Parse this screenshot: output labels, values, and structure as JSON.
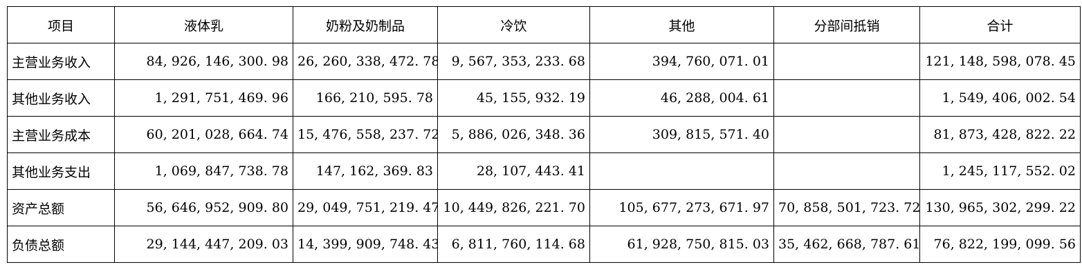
{
  "table": {
    "headers": [
      "项目",
      "液体乳",
      "奶粉及奶制品",
      "冷饮",
      "其他",
      "分部间抵销",
      "合计"
    ],
    "rows": [
      {
        "label": "主营业务收入",
        "cells": [
          "84, 926, 146, 300. 98",
          "26, 260, 338, 472. 78",
          "9, 567, 353, 233. 68",
          "394, 760, 071. 01",
          "",
          "121, 148, 598, 078. 45"
        ]
      },
      {
        "label": "其他业务收入",
        "cells": [
          "1, 291, 751, 469. 96",
          "166, 210, 595. 78",
          "45, 155, 932. 19",
          "46, 288, 004. 61",
          "",
          "1, 549, 406, 002. 54"
        ]
      },
      {
        "label": "主营业务成本",
        "cells": [
          "60, 201, 028, 664. 74",
          "15, 476, 558, 237. 72",
          "5, 886, 026, 348. 36",
          "309, 815, 571. 40",
          "",
          "81, 873, 428, 822. 22"
        ]
      },
      {
        "label": "其他业务支出",
        "cells": [
          "1, 069, 847, 738. 78",
          "147, 162, 369. 83",
          "28, 107, 443. 41",
          "",
          "",
          "1, 245, 117, 552. 02"
        ]
      },
      {
        "label": "资产总额",
        "cells": [
          "56, 646, 952, 909. 80",
          "29, 049, 751, 219. 47",
          "10, 449, 826, 221. 70",
          "105, 677, 273, 671. 97",
          "70, 858, 501, 723. 72",
          "130, 965, 302, 299. 22"
        ]
      },
      {
        "label": "负债总额",
        "cells": [
          "29, 144, 447, 209. 03",
          "14, 399, 909, 748. 43",
          "6, 811, 760, 114. 68",
          "61, 928, 750, 815. 03",
          "35, 462, 668, 787. 61",
          "76, 822, 199, 099. 56"
        ]
      }
    ]
  }
}
